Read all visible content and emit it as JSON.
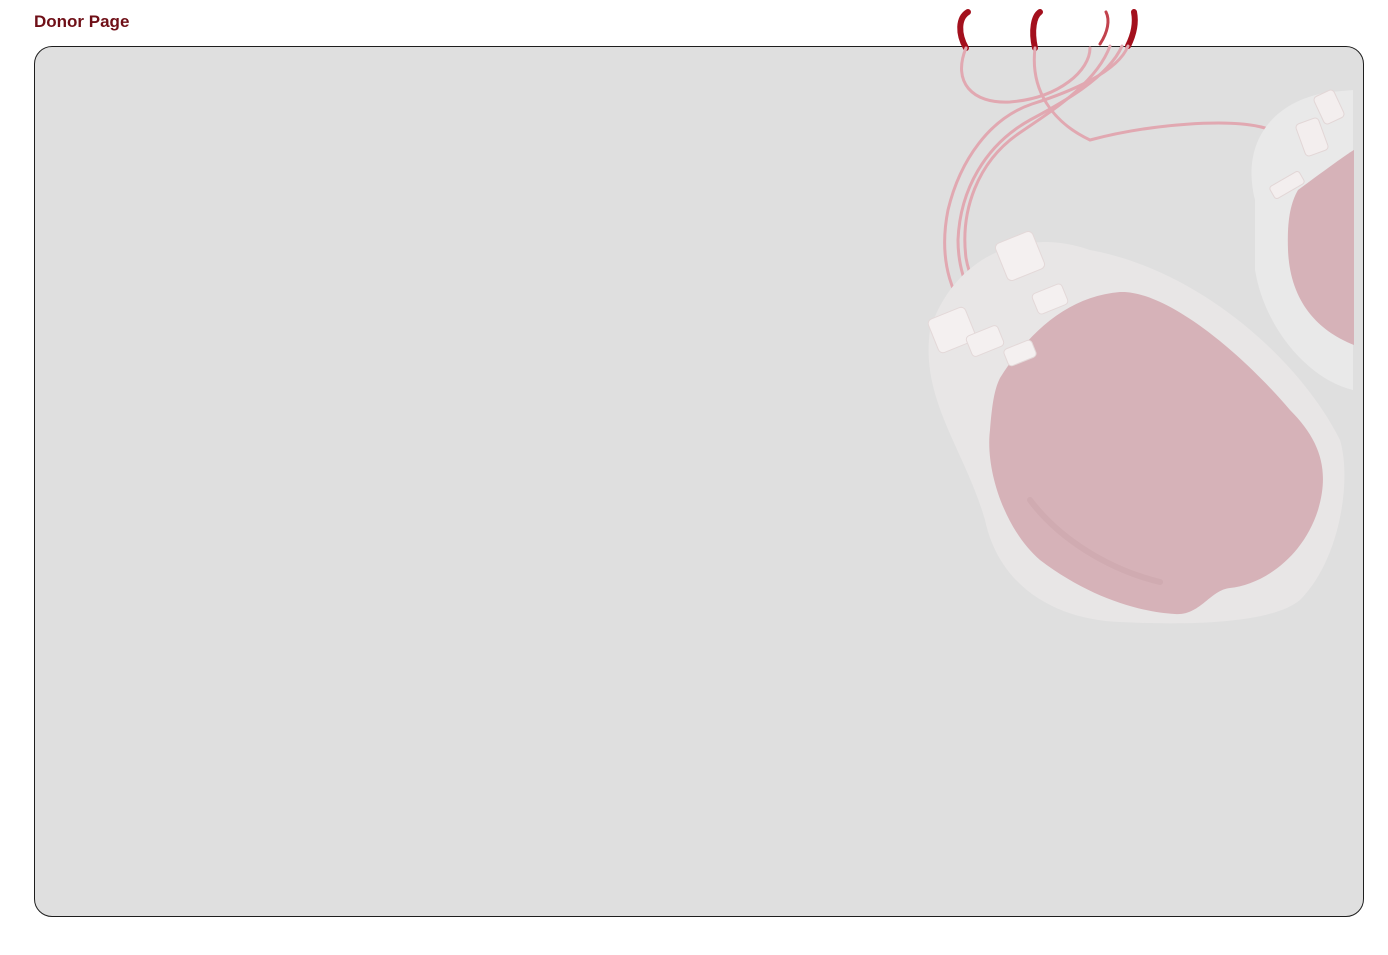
{
  "header": {
    "title": "Donor Page"
  },
  "colors": {
    "title_text": "#6f0f17",
    "panel_background": "#dfdfdf",
    "panel_border": "#1e1e1e",
    "bag_fill": "#d6b2b8",
    "tube_dark_red": "#a3101d",
    "tube_light_pink": "#e4aab3",
    "bag_halo": "#e9e9e9"
  },
  "illustration": {
    "icon": "blood-bag-illustration"
  }
}
